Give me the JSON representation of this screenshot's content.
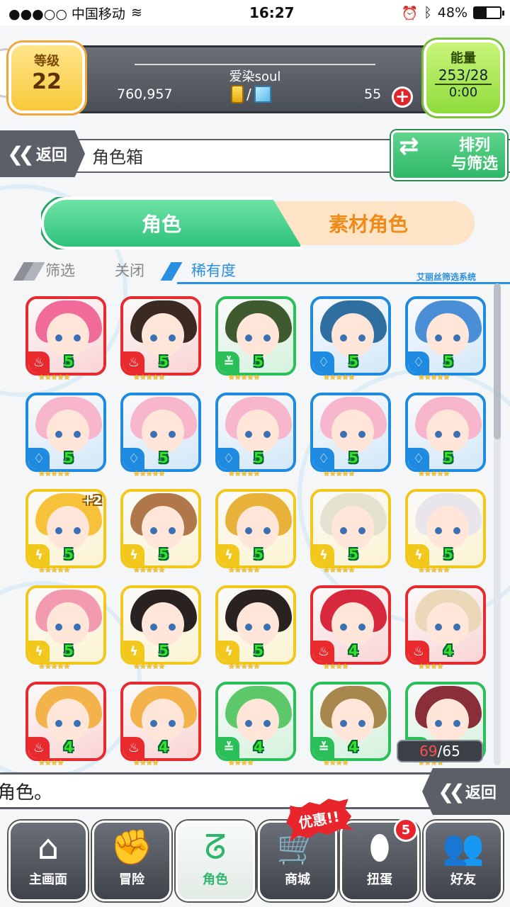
{
  "status_bar": {
    "carrier": "●●●○○ 中国移动",
    "time": "16:27",
    "battery": "48%",
    "battery_level": 0.48
  },
  "header": {
    "level_label": "等级",
    "level_value": "22",
    "username": "爱染soul",
    "coins": "760,957",
    "currency_sep": "/",
    "gems": "55",
    "plus_label": "+",
    "energy_label": "能量",
    "energy_value": "253/28",
    "energy_timer": "0:00"
  },
  "title_bar": {
    "back_label": "返回",
    "page_title": "角色箱",
    "sort_label_line1": "排列",
    "sort_label_line2": "与筛选"
  },
  "tabs": {
    "role": "角色",
    "material": "素材角色"
  },
  "filter": {
    "label": "筛选",
    "value": "关闭",
    "sort": "稀有度",
    "system": "艾丽丝筛选系统"
  },
  "attributes": {
    "fire": {
      "glyph": "♨",
      "color": "#e8292e"
    },
    "water": {
      "glyph": "♢",
      "color": "#1f8be0"
    },
    "wind": {
      "glyph": "≚",
      "color": "#2bbf5a"
    },
    "thunder": {
      "glyph": "ϟ",
      "color": "#f2c81d"
    }
  },
  "cards": [
    {
      "attr": "fire",
      "rarity": "5",
      "stars": "★★★★★",
      "hair": "#f06a9a",
      "plus": ""
    },
    {
      "attr": "fire",
      "rarity": "5",
      "stars": "★★★★★",
      "hair": "#3a2a22",
      "plus": ""
    },
    {
      "attr": "wind",
      "rarity": "5",
      "stars": "★★★★★",
      "hair": "#3f5a2e",
      "plus": ""
    },
    {
      "attr": "water",
      "rarity": "5",
      "stars": "★★★★★",
      "hair": "#2f6fa0",
      "plus": ""
    },
    {
      "attr": "water",
      "rarity": "5",
      "stars": "★★★★★",
      "hair": "#4a8ed6",
      "plus": ""
    },
    {
      "attr": "water",
      "rarity": "5",
      "stars": "★★★★★",
      "hair": "#f7b6cc",
      "plus": ""
    },
    {
      "attr": "water",
      "rarity": "5",
      "stars": "★★★★★",
      "hair": "#f7b6cc",
      "plus": ""
    },
    {
      "attr": "water",
      "rarity": "5",
      "stars": "★★★★★",
      "hair": "#f7b6cc",
      "plus": ""
    },
    {
      "attr": "water",
      "rarity": "5",
      "stars": "★★★★★",
      "hair": "#f7b6cc",
      "plus": ""
    },
    {
      "attr": "water",
      "rarity": "5",
      "stars": "★★★★★",
      "hair": "#f7b6cc",
      "plus": ""
    },
    {
      "attr": "thunder",
      "rarity": "5",
      "stars": "★★★★★",
      "hair": "#f7c23a",
      "plus": "+2"
    },
    {
      "attr": "thunder",
      "rarity": "5",
      "stars": "★★★★★",
      "hair": "#b0784a",
      "plus": ""
    },
    {
      "attr": "thunder",
      "rarity": "5",
      "stars": "★★★★★",
      "hair": "#e8b23a",
      "plus": ""
    },
    {
      "attr": "thunder",
      "rarity": "5",
      "stars": "★★★★★",
      "hair": "#e6e2d0",
      "plus": ""
    },
    {
      "attr": "thunder",
      "rarity": "5",
      "stars": "★★★★★",
      "hair": "#e8e6ea",
      "plus": ""
    },
    {
      "attr": "thunder",
      "rarity": "5",
      "stars": "★★★★★",
      "hair": "#f29ab0",
      "plus": ""
    },
    {
      "attr": "thunder",
      "rarity": "5",
      "stars": "★★★★★",
      "hair": "#2a2220",
      "plus": ""
    },
    {
      "attr": "thunder",
      "rarity": "5",
      "stars": "★★★★★",
      "hair": "#2a2220",
      "plus": ""
    },
    {
      "attr": "fire",
      "rarity": "4",
      "stars": "★★★★",
      "hair": "#d8283e",
      "plus": ""
    },
    {
      "attr": "fire",
      "rarity": "4",
      "stars": "★★★★",
      "hair": "#ead8b8",
      "plus": ""
    },
    {
      "attr": "fire",
      "rarity": "4",
      "stars": "★★★★",
      "hair": "#f3b24a",
      "plus": ""
    },
    {
      "attr": "fire",
      "rarity": "4",
      "stars": "★★★★",
      "hair": "#f3b24a",
      "plus": ""
    },
    {
      "attr": "wind",
      "rarity": "4",
      "stars": "★★★★",
      "hair": "#5cc86a",
      "plus": ""
    },
    {
      "attr": "wind",
      "rarity": "4",
      "stars": "★★★★",
      "hair": "#a8874e",
      "plus": ""
    },
    {
      "attr": "wind",
      "rarity": "",
      "stars": "★★★★",
      "hair": "#8a2f3a",
      "plus": ""
    }
  ],
  "counter": {
    "current": "69",
    "separator": "/",
    "max": "65"
  },
  "message": "角色。",
  "back_bottom_label": "返回",
  "nav": [
    {
      "label": "主画面",
      "icon": "⌂",
      "icon_name": "home-icon"
    },
    {
      "label": "冒险",
      "icon": "✊",
      "icon_name": "fist-icon"
    },
    {
      "label": "角色",
      "icon": "ᘔ",
      "icon_name": "rabbit-icon"
    },
    {
      "label": "商城",
      "icon": "🛒",
      "icon_name": "cart-icon"
    },
    {
      "label": "扭蛋",
      "icon": "⬮",
      "icon_name": "egg-icon"
    },
    {
      "label": "好友",
      "icon": "👥",
      "icon_name": "friends-icon"
    }
  ],
  "sale_badge": "优惠!!",
  "gacha_count": "5"
}
